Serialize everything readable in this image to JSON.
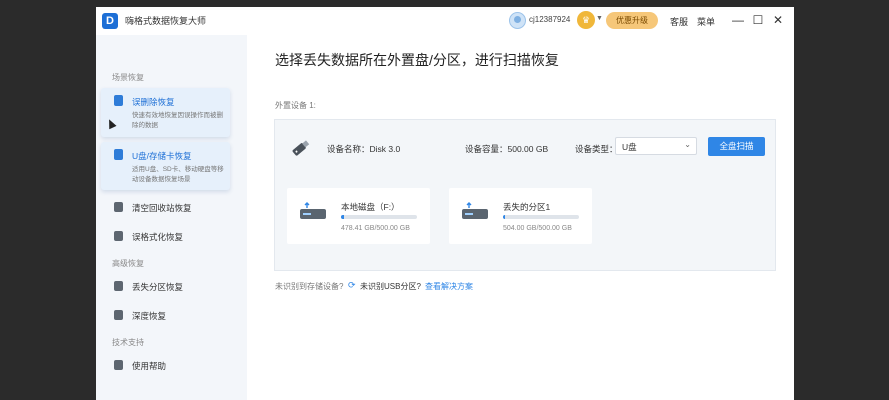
{
  "app": {
    "title": "嗨格式数据恢复大师",
    "logo_letter": "D",
    "user": "cj12387924",
    "upgrade": "优惠升级",
    "service": "客服",
    "menu": "菜单"
  },
  "window_controls": {
    "minimize": "—",
    "maximize": "☐",
    "close": "✕"
  },
  "sidebar": {
    "section1": "场景恢复",
    "card1": {
      "title": "误删除恢复",
      "desc": "快速有效地恢复因误操作而被删除的数据"
    },
    "card2": {
      "title": "U盘/存储卡恢复",
      "desc": "适用U盘、SD卡、移动硬盘等移动设备数据恢复场景"
    },
    "items_basic": [
      "清空回收站恢复",
      "误格式化恢复"
    ],
    "section2": "高级恢复",
    "items_advanced": [
      "丢失分区恢复",
      "深度恢复"
    ],
    "section3": "技术支持",
    "items_support": [
      "使用帮助"
    ]
  },
  "main": {
    "title": "选择丢失数据所在外置盘/分区，进行扫描恢复",
    "device_label": "外置设备 1:",
    "device_name": "设备名称：Disk 3.0",
    "device_capacity": "设备容量：500.00 GB",
    "device_type_label": "设备类型：",
    "device_type_value": "U盘",
    "scan_button": "全盘扫描",
    "partitions": [
      {
        "name": "本地磁盘（F:）",
        "size": "478.41 GB/500.00 GB",
        "fill_pct": 4
      },
      {
        "name": "丢失的分区1",
        "size": "504.00 GB/500.00 GB",
        "fill_pct": 2
      }
    ],
    "footer_question": "未识别到存储设备?",
    "footer_usb": "未识别USB分区?",
    "footer_link": "查看解决方案"
  },
  "colors": {
    "accent": "#2f86e6",
    "upgrade": "#f6c779",
    "vip": "#f0b73a"
  }
}
